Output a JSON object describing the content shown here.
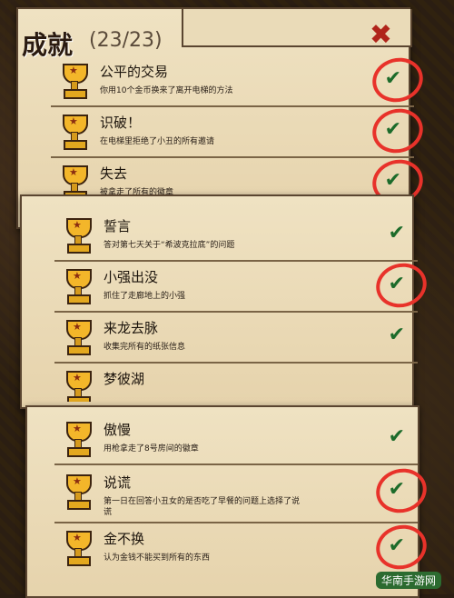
{
  "header": {
    "title": "成就",
    "count": "(23/23)",
    "close": "✖"
  },
  "panel1": {
    "items": [
      {
        "name": "公平的交易",
        "desc": "你用10个金币换来了离开电梯的方法",
        "circled": true
      },
      {
        "name": "识破！",
        "desc": "在电梯里拒绝了小丑的所有邀请",
        "circled": true
      },
      {
        "name": "失去",
        "desc": "被拿走了所有的徽章",
        "circled": true
      }
    ]
  },
  "panel2": {
    "items": [
      {
        "name": "誓言",
        "desc": "答对第七天关于“希波克拉底”的问题",
        "circled": false
      },
      {
        "name": "小强出没",
        "desc": "抓住了走廊地上的小强",
        "circled": true
      },
      {
        "name": "来龙去脉",
        "desc": "收集完所有的纸张信息",
        "circled": false
      },
      {
        "name": "梦彼湖",
        "desc": "",
        "circled": false
      }
    ]
  },
  "panel3": {
    "items": [
      {
        "name": "傲慢",
        "desc": "用枪拿走了8号房间的徽章",
        "circled": false
      },
      {
        "name": "说谎",
        "desc": "第一日在回答小丑女的是否吃了早餐的问题上选择了说谎",
        "circled": true
      },
      {
        "name": "金不换",
        "desc": "认为金钱不能买到所有的东西",
        "circled": true
      }
    ]
  },
  "icons": {
    "trophy": "trophy-icon",
    "check": "checkmark-icon",
    "close": "close-icon"
  },
  "colors": {
    "check": "#1c6b2a",
    "ring": "#e8322a",
    "close": "#b0241a"
  },
  "watermark": "华南手游网"
}
